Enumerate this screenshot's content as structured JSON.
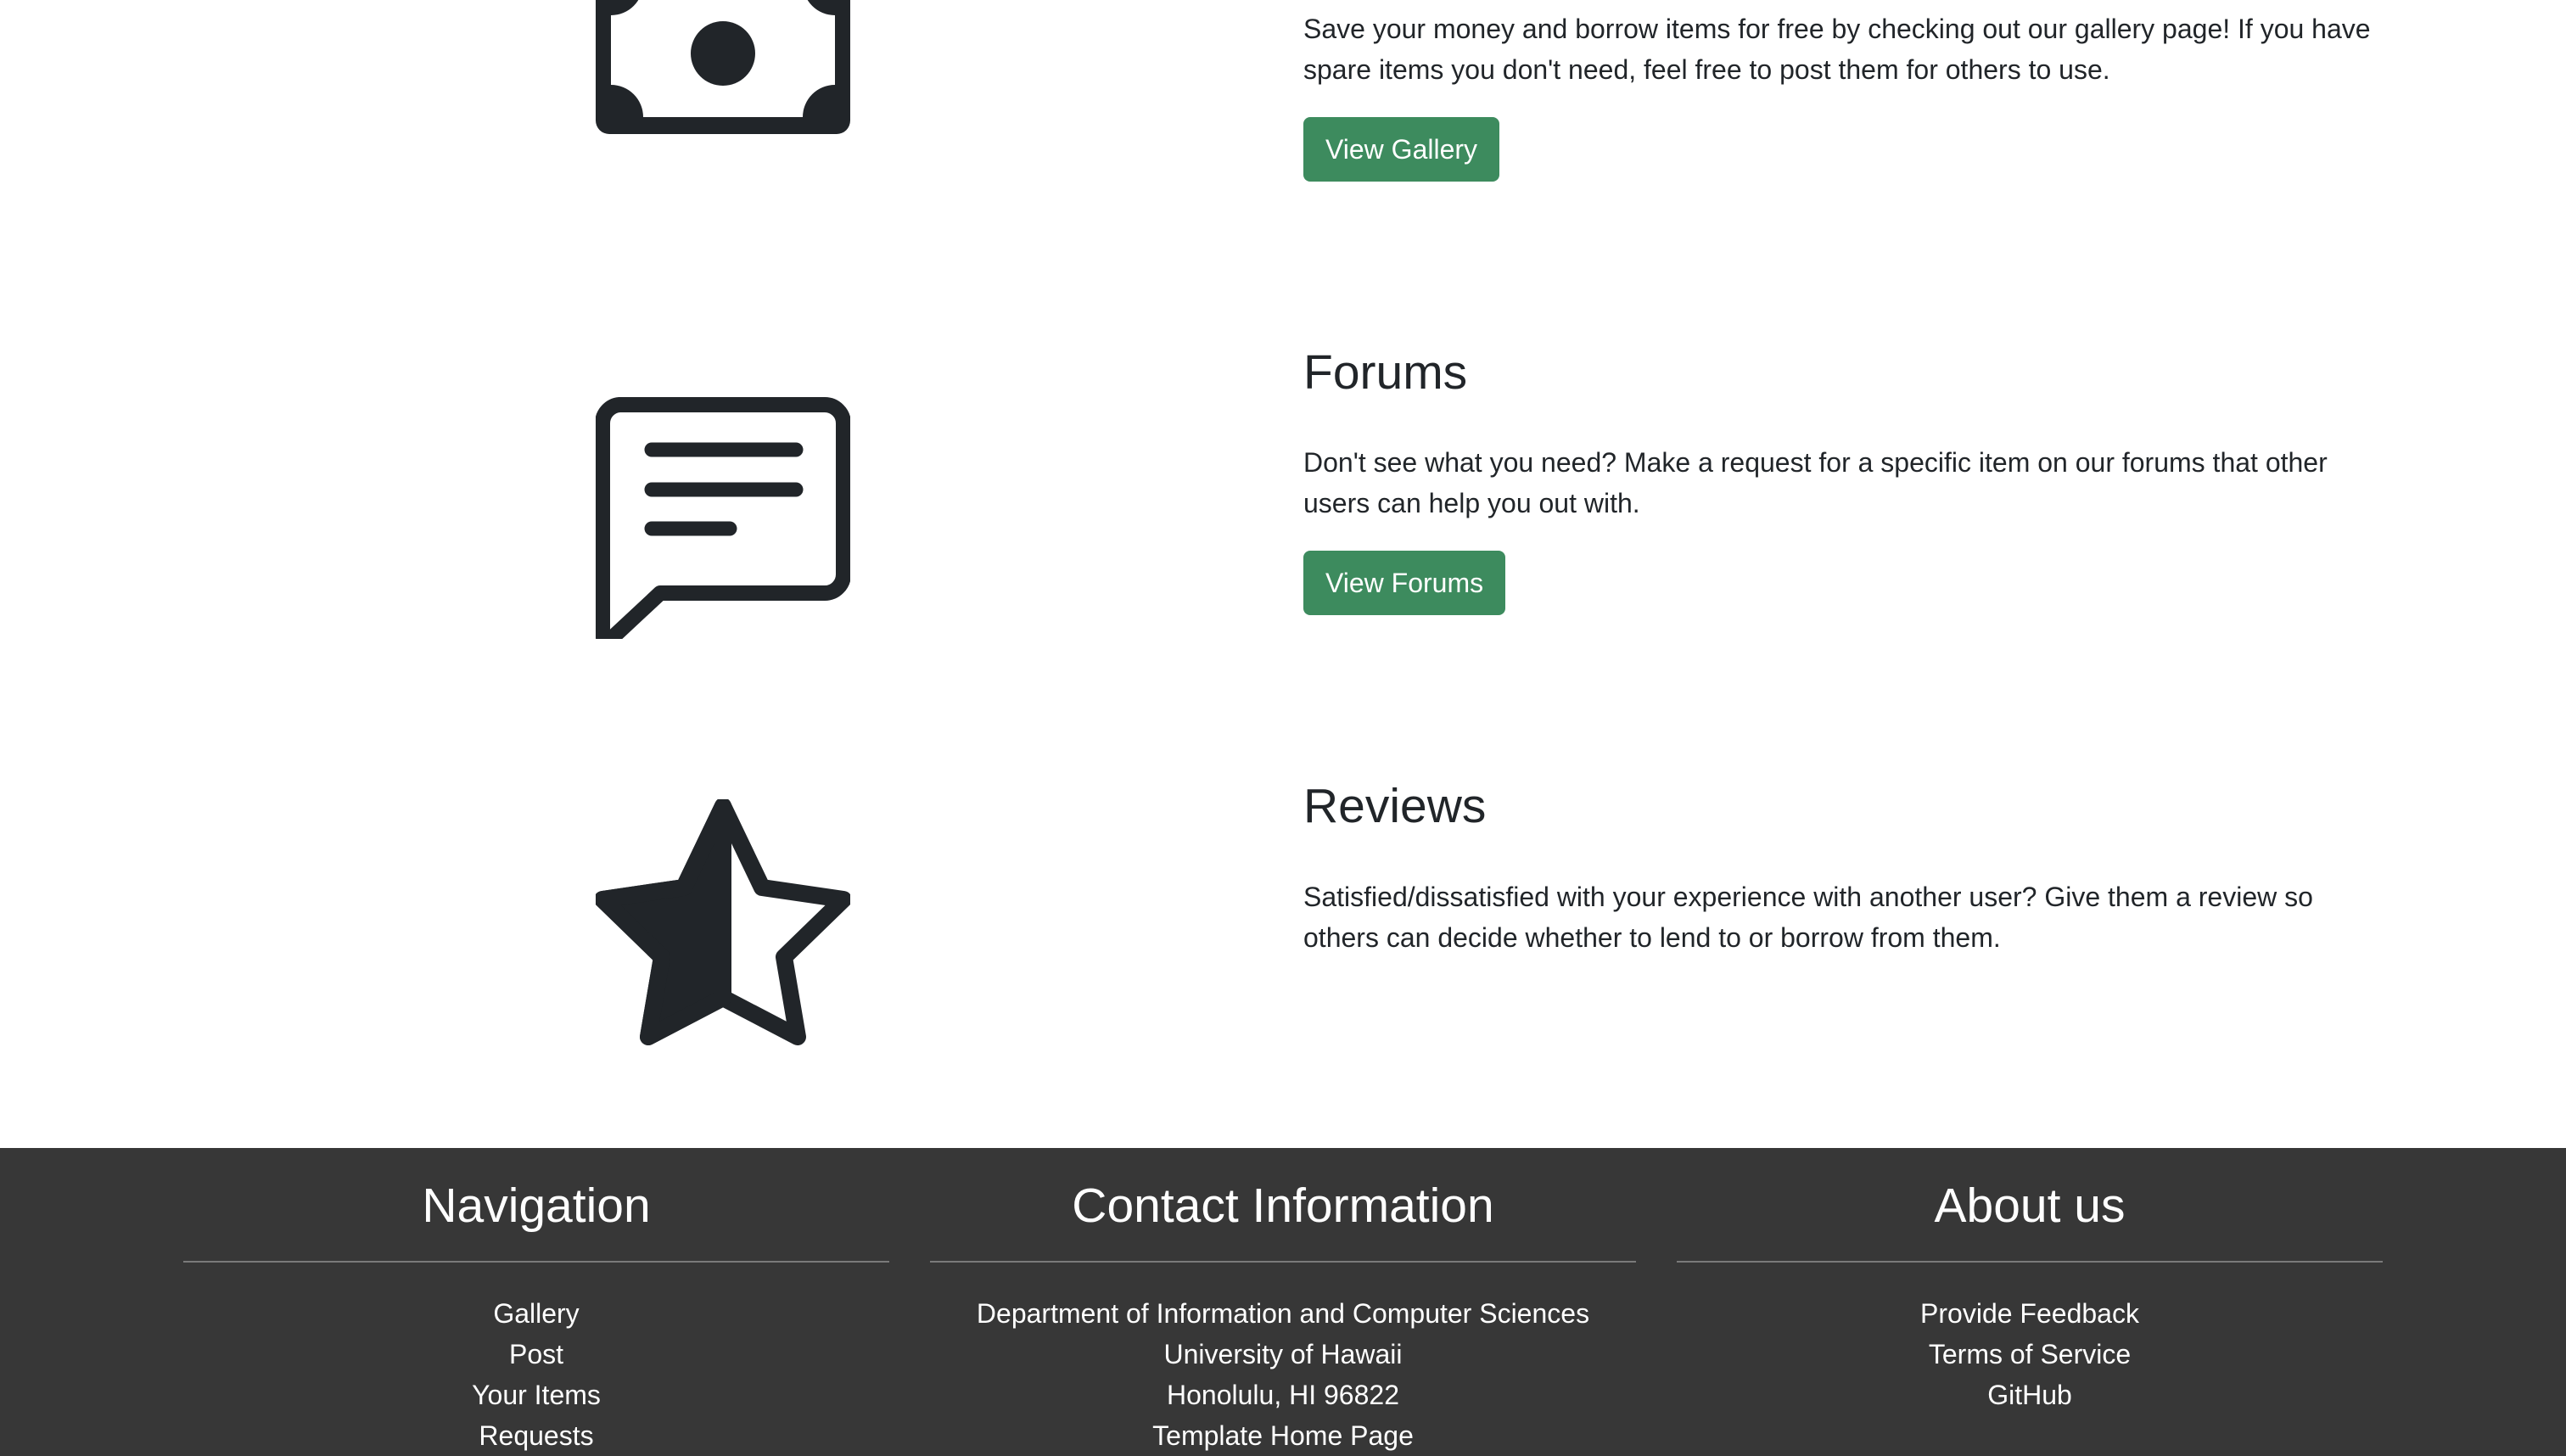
{
  "features": [
    {
      "icon": "cash-icon",
      "title": "",
      "text": "Save your money and borrow items for free by checking out our gallery page! If you have spare items you don't need, feel free to post them for others to use.",
      "button": "View Gallery"
    },
    {
      "icon": "chat-left-text-icon",
      "title": "Forums",
      "text": "Don't see what you need? Make a request for a specific item on our forums that other users can help you out with.",
      "button": "View Forums"
    },
    {
      "icon": "star-half-icon",
      "title": "Reviews",
      "text": "Satisfied/dissatisfied with your experience with another user? Give them a review so others can decide whether to lend to or borrow from them."
    }
  ],
  "footer": {
    "background": "#373737",
    "navigation": {
      "title": "Navigation",
      "items": [
        "Gallery",
        "Post",
        "Your Items",
        "Requests"
      ]
    },
    "contact": {
      "title": "Contact Information",
      "lines": [
        "Department of Information and Computer Sciences",
        "University of Hawaii",
        "Honolulu, HI 96822",
        "Template Home Page"
      ]
    },
    "about": {
      "title": "About us",
      "items": [
        "Provide Feedback",
        "Terms of Service",
        "GitHub"
      ]
    }
  },
  "colors": {
    "button": "#3d8b5e",
    "icon": "#212529"
  }
}
